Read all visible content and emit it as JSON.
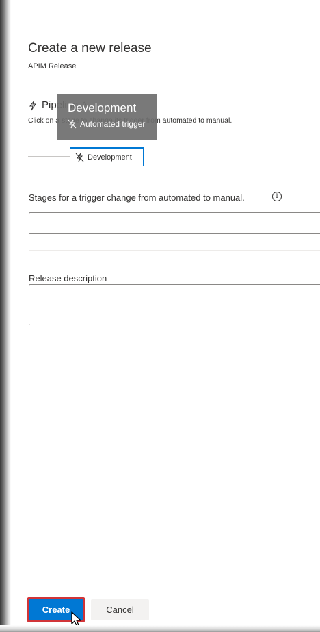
{
  "panel": {
    "title": "Create a new release",
    "subtitle": "APIM Release"
  },
  "pipeline": {
    "label": "Pipeline",
    "chevron": "^",
    "hint": "Click on a stage to change its trigger from automated to manual."
  },
  "tooltip": {
    "title": "Development",
    "trigger_label": "Automated trigger"
  },
  "stage": {
    "label": "Development"
  },
  "stages_field": {
    "label": "Stages for a trigger change from automated to manual.",
    "info_symbol": "i",
    "value": ""
  },
  "description_field": {
    "label": "Release description",
    "value": ""
  },
  "actions": {
    "create_label": "Create",
    "cancel_label": "Cancel"
  },
  "colors": {
    "accent": "#0078d4",
    "highlight_border": "#d13438"
  },
  "icons": {
    "pipeline": "lightning-bolt-icon",
    "stage": "lightning-bolt-off-icon",
    "info": "info-icon",
    "cursor": "mouse-pointer-icon"
  }
}
